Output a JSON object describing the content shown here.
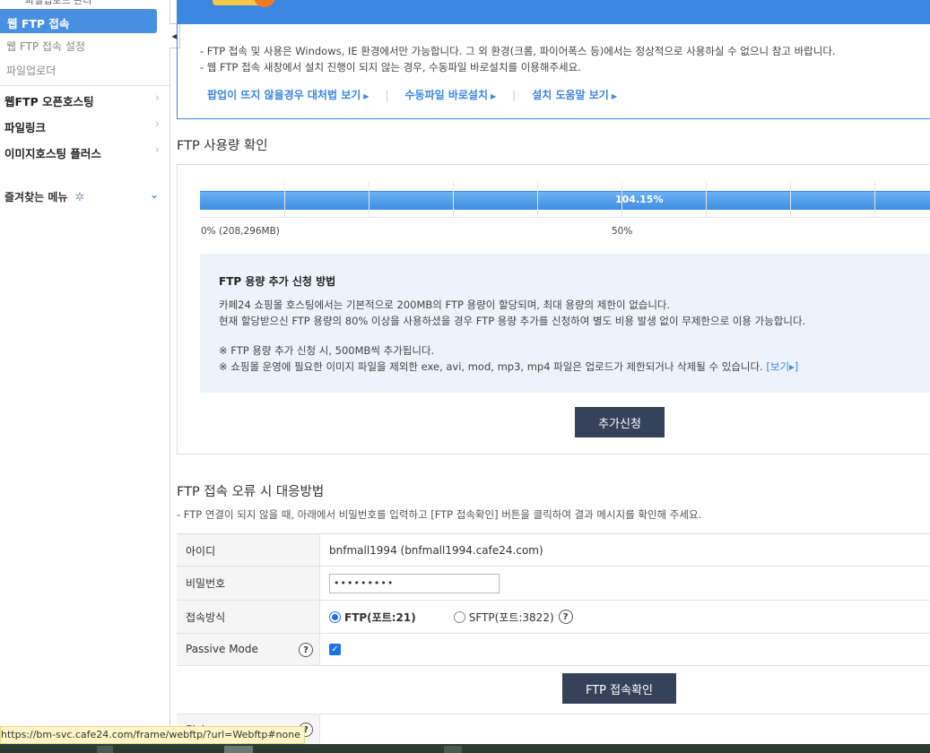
{
  "sidebar": {
    "cut_item": "파일업로드 관리",
    "active_item": "웹 FTP 접속",
    "sub_items": [
      "웹 FTP 접속 설정",
      "파일업로더"
    ],
    "menus": [
      "웹FTP 오픈호스팅",
      "파일링크",
      "이미지호스팅 플러스"
    ],
    "favorites_label": "즐겨찾는 메뉴",
    "icons": {
      "menu_chevron": "chevron-right-icon",
      "favorites_gear": "gear-icon",
      "favorites_toggle": "chevron-down-icon",
      "collapse": "triangle-left-icon"
    }
  },
  "notice": {
    "line1": "- FTP 접속 및 사용은 Windows, IE 환경에서만 가능합니다. 그 외 환경(크롬, 파이어폭스 등)에서는 정상적으로 사용하실 수 없으니 참고 바랍니다.",
    "line2": "- 웹 FTP 접속 새창에서 설치 진행이 되지 않는 경우, 수동파일 바로설치를 이용해주세요.",
    "links": [
      "팝업이 뜨지 않을경우 대처법 보기",
      "수동파일 바로설치",
      "설치 도움말 보기"
    ]
  },
  "usage": {
    "title": "FTP 사용량 확인",
    "percent": 104.15,
    "percent_label": "104.15%",
    "label_start": "0% (208,296MB)",
    "label_mid": "50%",
    "info": {
      "title": "FTP 용량 추가 신청 방법",
      "line1": "카페24 쇼핑몰 호스팅에서는 기본적으로 200MB의 FTP 용량이 할당되며, 최대 용량의 제한이 없습니다.",
      "line2": "현재 할당받으신 FTP 용량의 80% 이상을 사용하셨을 경우 FTP 용량 추가를 신청하여 별도 비용 발생 없이 무제한으로 이용 가능합니다.",
      "note1": "※ FTP 용량 추가 신청 시, 500MB씩 추가됩니다.",
      "note2": "※ 쇼핑몰 운영에 필요한 이미지 파일을 제외한 exe, avi, mod, mp3, mp4 파일은 업로드가 제한되거나 삭제될 수 있습니다.",
      "view_link": "[보기▸]"
    },
    "add_button": "추가신청"
  },
  "error_section": {
    "title": "FTP 접속 오류 시 대응방법",
    "description": "- FTP 연결이 되지 않을 때, 아래에서 비밀번호를 입력하고 [FTP 접속확인] 버튼을 클릭하여 결과 메시지를 확인해 주세요.",
    "rows": {
      "id_label": "아이디",
      "id_value": "bnfmall1994   (bnfmall1994.cafe24.com)",
      "pw_label": "비밀번호",
      "pw_value": "•••••••••",
      "method_label": "접속방식",
      "method_ftp": "FTP(포트:21)",
      "method_sftp": "SFTP(포트:3822)",
      "method_selected": "FTP",
      "passive_label": "Passive Mode",
      "passive_checked": true,
      "result_label": "결과"
    },
    "check_button": "FTP 접속확인",
    "help_glyph": "?"
  },
  "status_bar": {
    "url": "https://bm-svc.cafe24.com/frame/webftp/?url=Webftp#none"
  },
  "colors": {
    "accent": "#3b86e0",
    "active_nav": "#4a90e2",
    "dark_button": "#36425a",
    "info_bg": "#edf3fa"
  }
}
